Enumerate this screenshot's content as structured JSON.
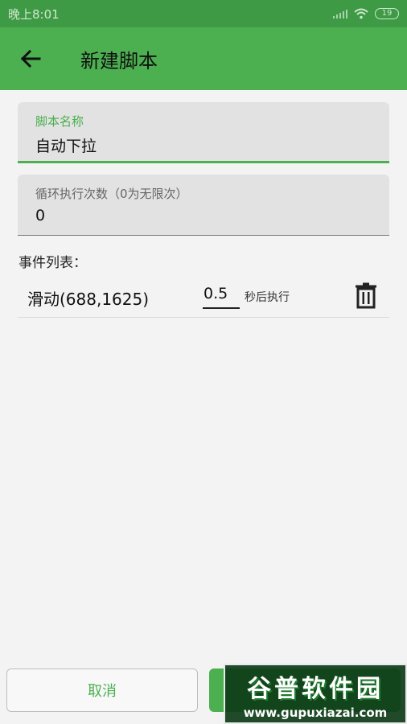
{
  "status_bar": {
    "time": "晚上8:01",
    "battery": "19"
  },
  "app_bar": {
    "title": "新建脚本"
  },
  "fields": {
    "name": {
      "label": "脚本名称",
      "value": "自动下拉"
    },
    "loop": {
      "label": "循环执行次数（0为无限次）",
      "value": "0"
    }
  },
  "events": {
    "label": "事件列表：",
    "items": [
      {
        "name": "滑动(688,1625)",
        "delay": "0.5",
        "suffix": "秒后执行"
      }
    ]
  },
  "buttons": {
    "cancel": "取消",
    "save": ""
  },
  "watermark": {
    "title": "谷普软件园",
    "url": "www.gupuxiazai.com"
  },
  "colors": {
    "primary": "#4caf50",
    "primary_dark": "#3e9a44"
  }
}
